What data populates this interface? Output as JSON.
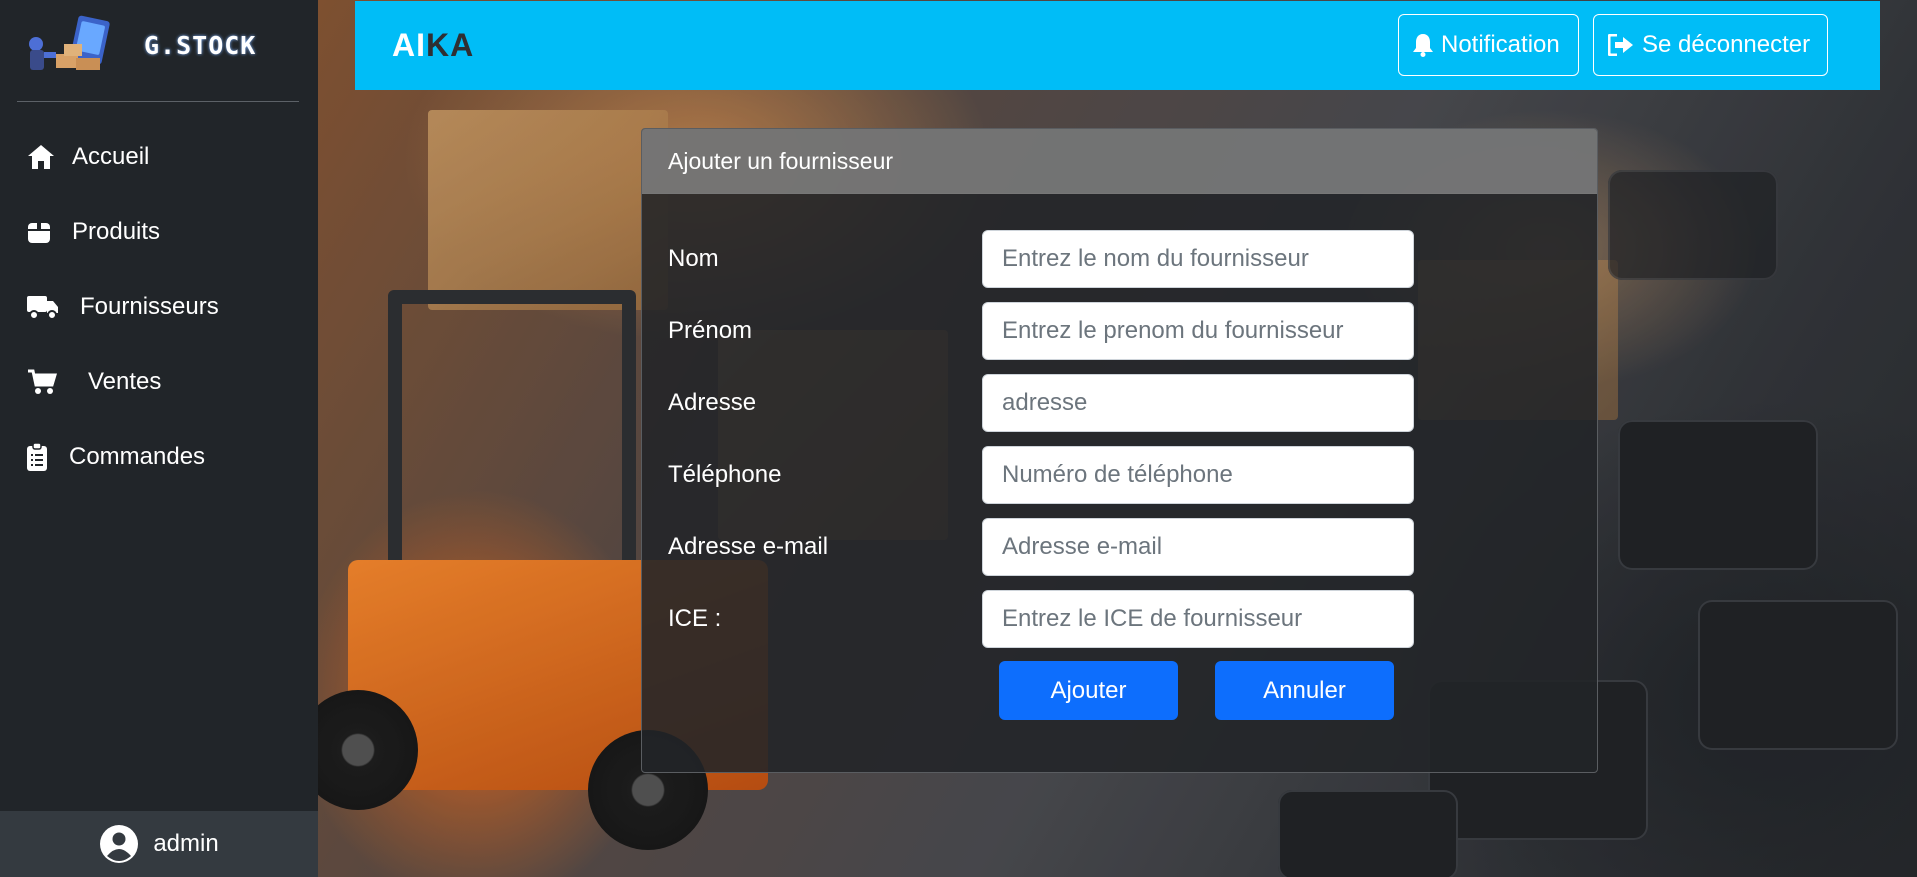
{
  "app": {
    "logo_text": "G.STOCK",
    "brand_light": "AI",
    "brand_dark": "KA"
  },
  "sidebar": {
    "items": [
      {
        "label": "Accueil",
        "icon": "home-icon"
      },
      {
        "label": "Produits",
        "icon": "box-icon"
      },
      {
        "label": "Fournisseurs",
        "icon": "truck-icon"
      },
      {
        "label": "Ventes",
        "icon": "cart-icon"
      },
      {
        "label": "Commandes",
        "icon": "clipboard-icon"
      }
    ],
    "user": {
      "name": "admin",
      "icon": "user-circle-icon"
    }
  },
  "topbar": {
    "notification_label": "Notification",
    "notification_icon": "bell-icon",
    "logout_label": "Se déconnecter",
    "logout_icon": "sign-out-icon",
    "color": "#00bdf7"
  },
  "form": {
    "title": "Ajouter un fournisseur",
    "fields": [
      {
        "label": "Nom",
        "placeholder": "Entrez le nom du fournisseur",
        "value": ""
      },
      {
        "label": "Prénom",
        "placeholder": "Entrez le prenom du fournisseur",
        "value": ""
      },
      {
        "label": "Adresse",
        "placeholder": "adresse",
        "value": ""
      },
      {
        "label": "Téléphone",
        "placeholder": "Numéro de téléphone",
        "value": ""
      },
      {
        "label": "Adresse e-mail",
        "placeholder": "Adresse e-mail",
        "value": ""
      },
      {
        "label": "ICE :",
        "placeholder": "Entrez le ICE de fournisseur",
        "value": ""
      }
    ],
    "submit_label": "Ajouter",
    "cancel_label": "Annuler",
    "button_color": "#0d6efd"
  }
}
